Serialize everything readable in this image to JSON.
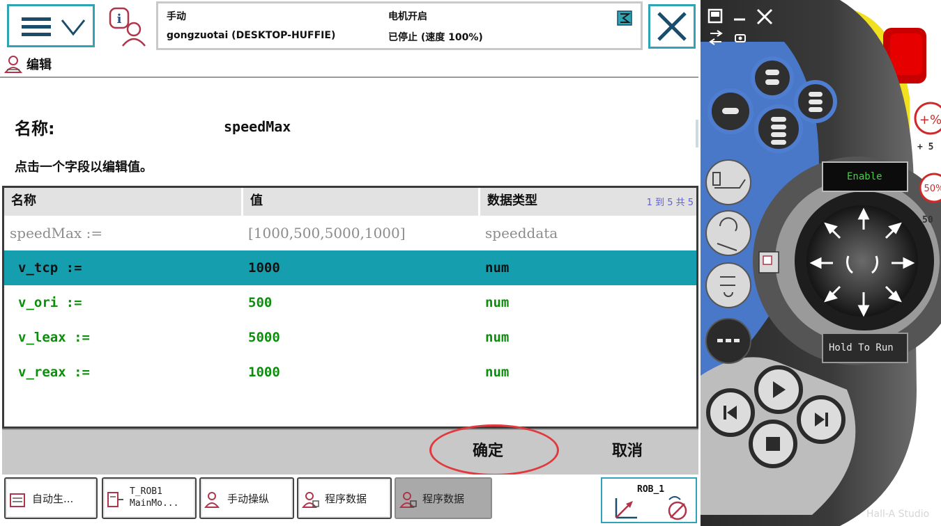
{
  "status": {
    "mode": "手动",
    "station": "gongzuotai (DESKTOP-HUFFIE)",
    "motor": "电机开启",
    "state": "已停止 (速度 100%)"
  },
  "window_title": "编辑",
  "form": {
    "name_label": "名称:",
    "name_value": "speedMax",
    "instruction": "点击一个字段以编辑值。"
  },
  "grid": {
    "headers": [
      "名称",
      "值",
      "数据类型"
    ],
    "pager": "1 到 5 共 5",
    "rows": [
      {
        "name": "speedMax :=",
        "value": "[1000,500,5000,1000]",
        "type": "speeddata"
      },
      {
        "name": "v_tcp :=",
        "value": "1000",
        "type": "num"
      },
      {
        "name": "v_ori :=",
        "value": "500",
        "type": "num"
      },
      {
        "name": "v_leax :=",
        "value": "5000",
        "type": "num"
      },
      {
        "name": "v_reax :=",
        "value": "1000",
        "type": "num"
      }
    ]
  },
  "actions": {
    "ok": "确定",
    "cancel": "取消"
  },
  "taskbar": {
    "items": [
      {
        "label": "自动生..."
      },
      {
        "label": "T_ROB1\nMainMo..."
      },
      {
        "label": "手动操纵"
      },
      {
        "label": "程序数据"
      },
      {
        "label": "程序数据"
      }
    ],
    "robot": "ROB_1"
  },
  "pendant": {
    "enable": "Enable",
    "hold": "Hold To Run",
    "side_labels": [
      "+ 5",
      "50"
    ],
    "watermark": "Hall-A Studio"
  },
  "colors": {
    "accent": "#159fae",
    "frame": "#2ea4b5",
    "value_green": "#0b8f0b",
    "highlight_ring": "#e0393e",
    "pendant_blue": "#4a78c8",
    "emergency_red": "#d80000",
    "yellow": "#f0e020"
  },
  "icons": {
    "menu": "hamburger-icon",
    "info": "info-user-icon",
    "close": "close-icon",
    "edit": "user-edit-icon",
    "robot": "coordinate-axis-icon"
  }
}
